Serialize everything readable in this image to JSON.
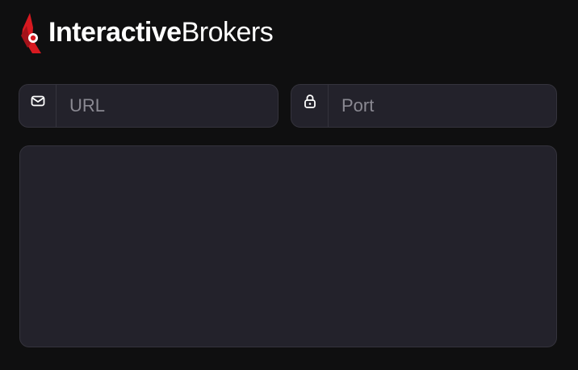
{
  "brand": {
    "name_bold": "Interactive",
    "name_light": "Brokers",
    "accent_color": "#d71920"
  },
  "form": {
    "url": {
      "icon": "mail-icon",
      "value": "",
      "placeholder": "URL"
    },
    "port": {
      "icon": "lock-icon",
      "value": "",
      "placeholder": "Port"
    }
  },
  "colors": {
    "background": "#0f0f10",
    "field_background": "#23222b",
    "field_border": "#34333c",
    "placeholder_text": "#8a8992"
  }
}
